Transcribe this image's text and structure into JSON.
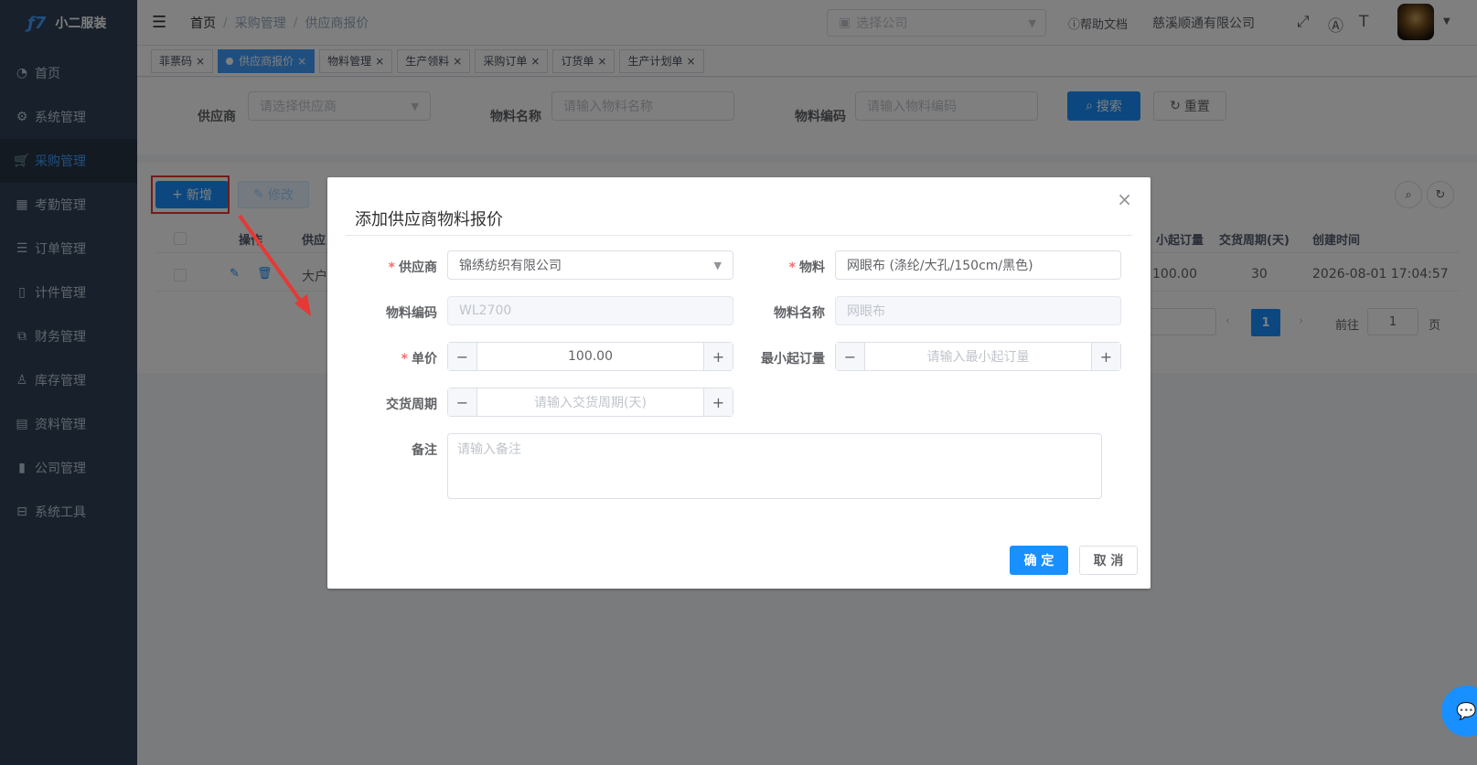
{
  "app": {
    "logo_mark": "ƒ7",
    "name": "小二服装"
  },
  "sidebar": {
    "items": [
      {
        "label": "首页",
        "icon": "dashboard-icon"
      },
      {
        "label": "系统管理",
        "icon": "gear-icon"
      },
      {
        "label": "采购管理",
        "icon": "cart-icon",
        "active": true
      },
      {
        "label": "考勤管理",
        "icon": "grid-icon"
      },
      {
        "label": "订单管理",
        "icon": "order-icon"
      },
      {
        "label": "计件管理",
        "icon": "book-icon"
      },
      {
        "label": "财务管理",
        "icon": "chart-icon"
      },
      {
        "label": "库存管理",
        "icon": "user-icon"
      },
      {
        "label": "资料管理",
        "icon": "document-icon"
      },
      {
        "label": "公司管理",
        "icon": "bar-chart-icon"
      },
      {
        "label": "系统工具",
        "icon": "toolbox-icon"
      }
    ]
  },
  "header": {
    "breadcrumb": [
      "首页",
      "采购管理",
      "供应商报价"
    ],
    "company_placeholder": "选择公司",
    "help": "帮助文档",
    "company": "慈溪顺通有限公司"
  },
  "tags": [
    {
      "label": "菲票码",
      "active": false
    },
    {
      "label": "供应商报价",
      "active": true
    },
    {
      "label": "物料管理",
      "active": false
    },
    {
      "label": "生产领料",
      "active": false
    },
    {
      "label": "采购订单",
      "active": false
    },
    {
      "label": "订货单",
      "active": false
    },
    {
      "label": "生产计划单",
      "active": false
    }
  ],
  "search": {
    "supplier_label": "供应商",
    "supplier_placeholder": "请选择供应商",
    "material_name_label": "物料名称",
    "material_name_placeholder": "请输入物料名称",
    "material_code_label": "物料编码",
    "material_code_placeholder": "请输入物料编码",
    "search_btn": "搜索",
    "reset_btn": "重置"
  },
  "toolbar": {
    "add": "新增",
    "edit": "修改"
  },
  "table": {
    "headers": {
      "op": "操作",
      "supplier": "供应",
      "moq": "小起订量",
      "lead": "交货周期(天)",
      "created": "创建时间"
    },
    "row": {
      "supplier": "大户",
      "moq": "100.00",
      "lead": "30",
      "created": "2026-08-01 17:04:57"
    }
  },
  "pager": {
    "current": "1",
    "goto_label": "前往",
    "goto_value": "1",
    "page_suffix": "页"
  },
  "dialog": {
    "title": "添加供应商物料报价",
    "supplier_label": "供应商",
    "supplier_value": "锦绣纺织有限公司",
    "material_label": "物料",
    "material_value": "网眼布 (涤纶/大孔/150cm/黑色)",
    "code_label": "物料编码",
    "code_value": "WL2700",
    "name_label": "物料名称",
    "name_value": "网眼布",
    "price_label": "单价",
    "price_value": "100.00",
    "moq_label": "最小起订量",
    "moq_placeholder": "请输入最小起订量",
    "lead_label": "交货周期",
    "lead_placeholder": "请输入交货周期(天)",
    "remark_label": "备注",
    "remark_placeholder": "请输入备注",
    "ok": "确 定",
    "cancel": "取 消"
  },
  "colors": {
    "primary": "#1890ff",
    "sidebar": "#304156",
    "highlight": "#e53935"
  }
}
